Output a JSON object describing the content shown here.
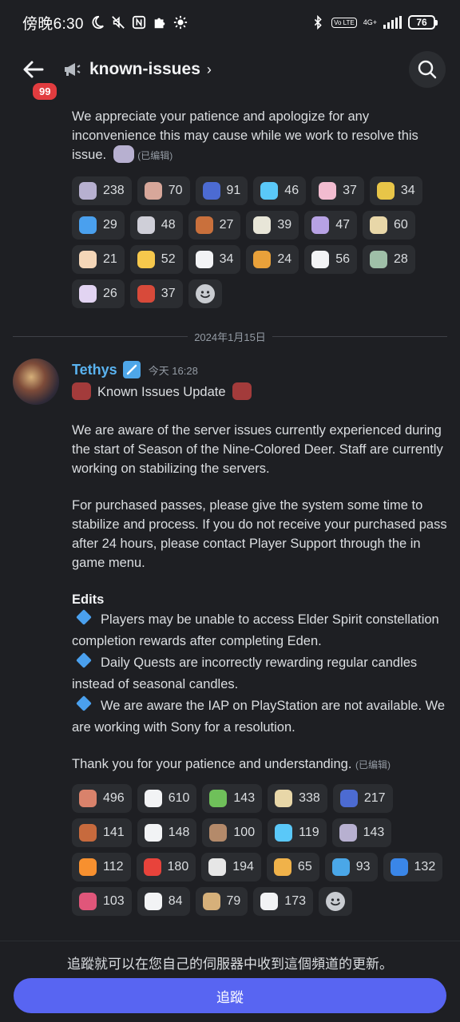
{
  "status_bar": {
    "time": "傍晚6:30",
    "volte": "Vo LTE",
    "network": "4G+",
    "battery": "76"
  },
  "header": {
    "unread_badge": "99",
    "channel_name": "known-issues",
    "chevron": "›"
  },
  "first_message": {
    "text": "We appreciate your patience and apologize for any inconvenience this may cause while we work to resolve this issue.",
    "edited_label": "(已编辑)",
    "reactions": [
      {
        "icon": "hug-icon",
        "color": "#b7b0d0",
        "count": "238"
      },
      {
        "icon": "girl-face-icon",
        "color": "#d7a79a",
        "count": "70"
      },
      {
        "icon": "thank-you-icon",
        "color": "#4c6bd2",
        "count": "91"
      },
      {
        "icon": "blue-heart-icon",
        "color": "#5ac8f8",
        "count": "46"
      },
      {
        "icon": "piggy-icon",
        "color": "#f2bcd0",
        "count": "37"
      },
      {
        "icon": "banana-icon",
        "color": "#e8c548",
        "count": "34"
      },
      {
        "icon": "swim-icon",
        "color": "#4aa0ee",
        "count": "29"
      },
      {
        "icon": "hug-pair-icon",
        "color": "#cfcfd8",
        "count": "48"
      },
      {
        "icon": "monkey-icon",
        "color": "#c9703c",
        "count": "27"
      },
      {
        "icon": "dance-icon",
        "color": "#e8e6d8",
        "count": "39"
      },
      {
        "icon": "sparkle-person-icon",
        "color": "#b7a2e4",
        "count": "47"
      },
      {
        "icon": "crying-bird-icon",
        "color": "#e8d7a8",
        "count": "60"
      },
      {
        "icon": "egg-icon",
        "color": "#f4d6b8",
        "count": "21"
      },
      {
        "icon": "sob-icon",
        "color": "#f6c84c",
        "count": "52"
      },
      {
        "icon": "star-jump-icon",
        "color": "#f2f3f5",
        "count": "34"
      },
      {
        "icon": "bread-icon",
        "color": "#e9a13a",
        "count": "24"
      },
      {
        "icon": "wave-hand-icon",
        "color": "#f2f3f5",
        "count": "56"
      },
      {
        "icon": "crab-face-icon",
        "color": "#9fbfa8",
        "count": "28"
      },
      {
        "icon": "unicorn-icon",
        "color": "#e2d4f2",
        "count": "26"
      },
      {
        "icon": "fire-fight-icon",
        "color": "#d84a3a",
        "count": "37"
      }
    ]
  },
  "date_divider": "2024年1月15日",
  "second_message": {
    "author": "Tethys",
    "timestamp": "今天 16:28",
    "title": "Known Issues Update",
    "para1": "We are aware of the server issues currently experienced during the start of Season of the Nine-Colored Deer. Staff are currently working on stabilizing the servers.",
    "para2": "For purchased passes, please give the system some time to stabilize and process. If you do not receive your purchased pass after 24 hours, please contact Player Support through the in game menu.",
    "edits_heading": "Edits",
    "edits": [
      "Players may be unable to access Elder Spirit constellation completion rewards after completing Eden.",
      "Daily Quests are incorrectly rewarding regular candles instead of seasonal candles.",
      "We are aware the IAP on PlayStation are not available. We are working with Sony for a resolution."
    ],
    "closing": "Thank you for your patience and understanding.",
    "edited_label": "(已编辑)",
    "reactions": [
      {
        "icon": "candle-gift-icon",
        "color": "#d9826b",
        "count": "496"
      },
      {
        "icon": "point-hand-icon",
        "color": "#f2f3f5",
        "count": "610"
      },
      {
        "icon": "leaf-pot-icon",
        "color": "#6fc05a",
        "count": "143"
      },
      {
        "icon": "crying-bird-icon",
        "color": "#e8d7a8",
        "count": "338"
      },
      {
        "icon": "thank-you-icon",
        "color": "#4c6bd2",
        "count": "217"
      },
      {
        "icon": "ox-icon",
        "color": "#c76a3d",
        "count": "141"
      },
      {
        "icon": "figure-icon",
        "color": "#f2f3f5",
        "count": "148"
      },
      {
        "icon": "bat-icon",
        "color": "#b48a6a",
        "count": "100"
      },
      {
        "icon": "blue-heart-icon",
        "color": "#5ac8f8",
        "count": "119"
      },
      {
        "icon": "hug-icon",
        "color": "#b7b0d0",
        "count": "143"
      },
      {
        "icon": "fire-icon",
        "color": "#f7902f",
        "count": "112"
      },
      {
        "icon": "anger-icon",
        "color": "#e8433b",
        "count": "180"
      },
      {
        "icon": "skull-icon",
        "color": "#e6e6e6",
        "count": "194"
      },
      {
        "icon": "dancer-icon",
        "color": "#f0b24a",
        "count": "65"
      },
      {
        "icon": "whale-icon",
        "color": "#4aa7e8",
        "count": "93"
      },
      {
        "icon": "ok-button-icon",
        "color": "#3a86e8",
        "count": "132"
      },
      {
        "icon": "heart-gift-icon",
        "color": "#e0567a",
        "count": "103"
      },
      {
        "icon": "wave-figure-icon",
        "color": "#f2f3f5",
        "count": "84"
      },
      {
        "icon": "party-icon",
        "color": "#d6b07a",
        "count": "79"
      },
      {
        "icon": "ghost-figure-icon",
        "color": "#f2f3f5",
        "count": "173"
      }
    ]
  },
  "bottom": {
    "follow_note": "追蹤就可以在您自己的伺服器中收到這個頻道的更新。",
    "follow_button": "追蹤"
  }
}
